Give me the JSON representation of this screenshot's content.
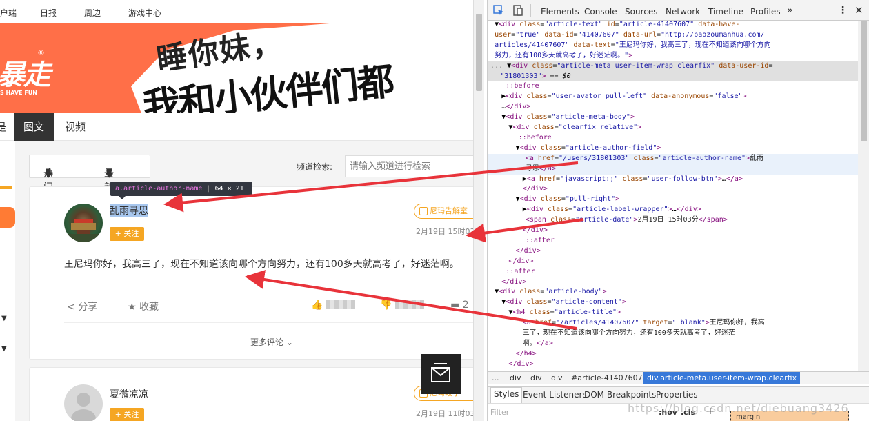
{
  "page": {
    "topnav": [
      "户端",
      "日报",
      "周边",
      "游戏中心"
    ],
    "banner": {
      "logo_cn": "暴走",
      "logo_mark": "®",
      "logo_en": "S HAVE FUN",
      "slogan_1": "睡你妹，",
      "slogan_2": "我和小伙伴们都"
    },
    "subnav": {
      "tab_partial": "是",
      "tab_active": "图文",
      "tab_video": "视频"
    },
    "sort": {
      "hot": "热门",
      "latest": "最新"
    },
    "channel_filter": {
      "label": "频道检索:",
      "placeholder": "请输入频道进行检索"
    },
    "card1": {
      "author": "乱雨寻思",
      "follow": "+ 关注",
      "label": "尼玛告解室",
      "date": "2月19日 15时03分",
      "text": "王尼玛你好，我高三了，现在不知道该向哪个方向努力，还有100多天就高考了，好迷茫啊。",
      "share": "分享",
      "collect": "收藏",
      "comment_count": "2",
      "more_comments": "更多评论"
    },
    "card2": {
      "author": "夏微凉凉",
      "follow": "+ 关注",
      "label": "尼玛段子",
      "date": "2月19日 11时03分"
    },
    "tooltip": {
      "selector": "a.article-author-name",
      "size": "64 × 21"
    }
  },
  "devtools": {
    "tabs": [
      "Elements",
      "Console",
      "Sources",
      "Network",
      "Timeline",
      "Profiles",
      "»"
    ],
    "dom_lines": [
      {
        "indent": 6,
        "html": "▼<span class=tg>&lt;div</span> <span class=at>class</span>=<span class=av>\"article-text\"</span> <span class=at>id</span>=<span class=av>\"article-41407607\"</span> <span class=at>data-have-</span>"
      },
      {
        "indent": 6,
        "html": "<span class=at>user</span>=<span class=av>\"true\"</span> <span class=at>data-id</span>=<span class=av>\"41407607\"</span> <span class=at>data-url</span>=<span class=av>\"http://baozoumanhua.com/</span>"
      },
      {
        "indent": 6,
        "html": "<span class=av>articles/41407607\"</span> <span class=at>data-text</span>=<span class=av>\"王尼玛你好，我高三了，现在不知道该向哪个方向</span>"
      },
      {
        "indent": 6,
        "html": "<span class=av>努力，还有100多天就高考了，好迷茫啊。\"</span><span class=tg>&gt;</span>"
      },
      {
        "indent": 0,
        "cls": "sel-row",
        "html": "<span style='color:#888'>...</span>   ▼<span class=tg>&lt;div</span> <span class=at>class</span>=<span class=av>\"article-meta user-item-wrap clearfix\"</span> <span class=at>data-user-id</span>="
      },
      {
        "indent": 14,
        "cls": "sel-row",
        "html": "<span class=av>\"31801303\"</span><span class=tg>&gt;</span> == <i>$0</i>"
      },
      {
        "indent": 22,
        "html": "<span class=ps>::before</span>"
      },
      {
        "indent": 16,
        "html": "▶<span class=tg>&lt;div</span> <span class=at>class</span>=<span class=av>\"user-avator pull-left\"</span> <span class=at>data-anonymous</span>=<span class=av>\"false\"</span><span class=tg>&gt;</span>"
      },
      {
        "indent": 16,
        "html": "…<span class=tg>&lt;/div&gt;</span>"
      },
      {
        "indent": 16,
        "html": "▼<span class=tg>&lt;div</span> <span class=at>class</span>=<span class=av>\"article-meta-body\"</span><span class=tg>&gt;</span>"
      },
      {
        "indent": 26,
        "html": "▼<span class=tg>&lt;div</span> <span class=at>class</span>=<span class=av>\"clearfix relative\"</span><span class=tg>&gt;</span>"
      },
      {
        "indent": 40,
        "html": "<span class=ps>::before</span>"
      },
      {
        "indent": 36,
        "html": "▼<span class=tg>&lt;div</span> <span class=at>class</span>=<span class=av>\"article-author-field\"</span><span class=tg>&gt;</span>"
      },
      {
        "indent": 50,
        "cls": "hov-row",
        "html": "<span class=tg>&lt;a</span> <span class=at>href</span>=<span class=av>\"/users/31801303\"</span> <span class=at>class</span>=<span class=av>\"article-author-name\"</span><span class=tg>&gt;</span><span class=tx>乱雨</span>"
      },
      {
        "indent": 50,
        "cls": "hov-row",
        "html": "<span class=tx>寻思</span><span class=tg>&lt;/a&gt;</span>"
      },
      {
        "indent": 46,
        "html": "▶<span class=tg>&lt;a</span> <span class=at>href</span>=<span class=av>\"javascript:;\"</span> <span class=at>class</span>=<span class=av>\"user-follow-btn\"</span><span class=tg>&gt;</span>…<span class=tg>&lt;/a&gt;</span>"
      },
      {
        "indent": 46,
        "html": "<span class=tg>&lt;/div&gt;</span>"
      },
      {
        "indent": 36,
        "html": "▼<span class=tg>&lt;div</span> <span class=at>class</span>=<span class=av>\"pull-right\"</span><span class=tg>&gt;</span>"
      },
      {
        "indent": 46,
        "html": "▶<span class=tg>&lt;div</span> <span class=at>class</span>=<span class=av>\"article-label-wrapper\"</span><span class=tg>&gt;</span>…<span class=tg>&lt;/div&gt;</span>"
      },
      {
        "indent": 50,
        "html": "<span class=tg>&lt;span</span> <span class=at>class</span>=<span class=av>\"article-date\"</span><span class=tg>&gt;</span><span class=tx>2月19日 15时03分</span><span class=tg>&lt;/span&gt;</span>"
      },
      {
        "indent": 46,
        "html": "<span class=tg>&lt;/div&gt;</span>"
      },
      {
        "indent": 50,
        "html": "<span class=ps>::after</span>"
      },
      {
        "indent": 36,
        "html": "<span class=tg>&lt;/div&gt;</span>"
      },
      {
        "indent": 26,
        "html": "<span class=tg>&lt;/div&gt;</span>"
      },
      {
        "indent": 22,
        "html": "<span class=ps>::after</span>"
      },
      {
        "indent": 16,
        "html": "<span class=tg>&lt;/div&gt;</span>"
      },
      {
        "indent": 6,
        "html": "▼<span class=tg>&lt;div</span> <span class=at>class</span>=<span class=av>\"article-body\"</span><span class=tg>&gt;</span>"
      },
      {
        "indent": 16,
        "html": "▼<span class=tg>&lt;div</span> <span class=at>class</span>=<span class=av>\"article-content\"</span><span class=tg>&gt;</span>"
      },
      {
        "indent": 26,
        "html": "▼<span class=tg>&lt;h4</span> <span class=at>class</span>=<span class=av>\"article-title\"</span><span class=tg>&gt;</span>"
      },
      {
        "indent": 46,
        "html": "<span class=tg>&lt;a</span> <span class=at>href</span>=<span class=av>\"/articles/41407607\"</span> <span class=at>target</span>=<span class=av>\"_blank\"</span><span class=tg>&gt;</span><span class=tx>王尼玛你好，我高</span>"
      },
      {
        "indent": 46,
        "html": "<span class=tx>三了，现在不知道该向哪个方向努力，还有100多天就高考了，好迷茫</span>"
      },
      {
        "indent": 46,
        "html": "<span class=tx>啊。</span><span class=tg>&lt;/a&gt;</span>"
      },
      {
        "indent": 36,
        "html": "<span class=tg>&lt;/h4&gt;</span>"
      },
      {
        "indent": 26,
        "html": "<span class=tg>&lt;/div&gt;</span>"
      },
      {
        "indent": 16,
        "html": "▶<span class=tg>&lt;div</span> <span class=at>class</span>=<span class=av>\"article-controls-btns clearfix\"</span><span class=tg>&gt;</span>…<span class=tg>&lt;/div&gt;</span>"
      }
    ],
    "breadcrumbs": [
      "...",
      "div",
      "div",
      "div",
      "#article-41407607",
      "div.article-meta.user-item-wrap.clearfix"
    ],
    "subtabs": [
      "Styles",
      "Event Listeners",
      "DOM Breakpoints",
      "Properties"
    ],
    "filter": {
      "placeholder": "Filter",
      "hov": ":hov",
      "cls": ".cls",
      "plus": "+",
      "box_label": "margin"
    },
    "watermark": "https://blog.csdn.net/diebuang3426"
  },
  "colors": {
    "accent_orange": "#f5a623",
    "banner_orange": "#ff6f48",
    "annotation_red": "#e8333a",
    "selection_blue": "#3879d9"
  }
}
